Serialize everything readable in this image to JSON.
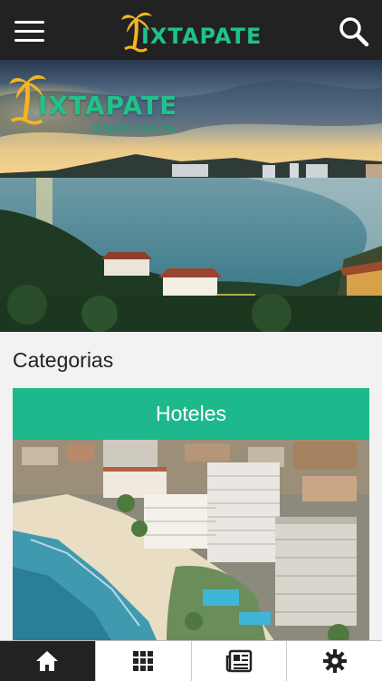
{
  "header": {
    "logo_text": "IXTAPATE",
    "menu_icon": "hamburger-menu-icon",
    "search_icon": "search-icon"
  },
  "hero": {
    "logo_text": "IXTAPATE",
    "url": "ixtapate.com.mx"
  },
  "categories": {
    "title": "Categorias",
    "items": [
      {
        "label": "Hoteles"
      }
    ]
  },
  "tabbar": {
    "items": [
      {
        "icon": "home-icon",
        "active": true
      },
      {
        "icon": "grid-icon",
        "active": false
      },
      {
        "icon": "newspaper-icon",
        "active": false
      },
      {
        "icon": "gear-icon",
        "active": false
      }
    ]
  },
  "colors": {
    "accent": "#1db98c",
    "topbar": "#222222"
  }
}
